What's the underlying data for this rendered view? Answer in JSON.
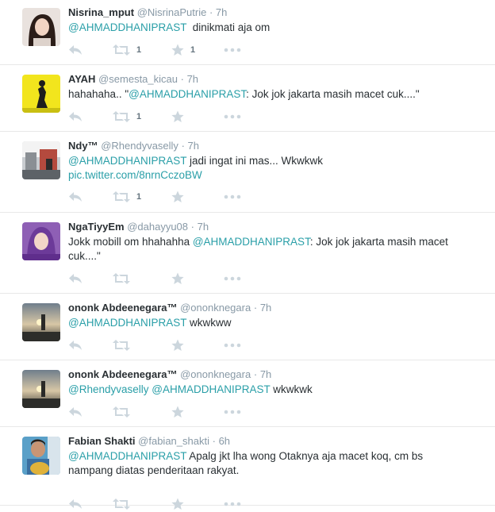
{
  "colors": {
    "link": "#2a9fa8",
    "muted": "#8899a6",
    "icon": "#ccd6dd"
  },
  "tweets": [
    {
      "fullname": "Nisrina_mput",
      "username": "@NisrinaPutrie",
      "sep": "·",
      "time": "7h",
      "text": [
        {
          "t": "@AHMADDHANIPRAST",
          "k": "mention"
        },
        {
          "t": "  dinikmati aja om",
          "k": "plain"
        }
      ],
      "retweets": "1",
      "favorites": "1",
      "avatar_icon": "avatar-girl-icon"
    },
    {
      "fullname": "AYAH",
      "username": "@semesta_kicau",
      "sep": "·",
      "time": "7h",
      "text": [
        {
          "t": "hahahaha.. \"",
          "k": "plain"
        },
        {
          "t": "@AHMADDHANIPRAST",
          "k": "mention"
        },
        {
          "t": ": Jok jok jakarta masih macet cuk....\"",
          "k": "plain"
        }
      ],
      "retweets": "1",
      "favorites": "",
      "avatar_icon": "avatar-yellow-figure-icon"
    },
    {
      "fullname": "Ndy™",
      "username": "@Rhendyvaselly",
      "sep": "·",
      "time": "7h",
      "text": [
        {
          "t": "@AHMADDHANIPRAST",
          "k": "mention"
        },
        {
          "t": " jadi ingat ini mas... Wkwkwk",
          "k": "plain"
        },
        {
          "t": "\n",
          "k": "br"
        },
        {
          "t": "pic.twitter.com/8nrnCczoBW",
          "k": "link"
        }
      ],
      "retweets": "1",
      "favorites": "",
      "avatar_icon": "avatar-street-icon"
    },
    {
      "fullname": "NgaTiyyEm",
      "username": "@dahayyu08",
      "sep": "·",
      "time": "7h",
      "text": [
        {
          "t": "Jokk mobill om hhahahha ",
          "k": "plain"
        },
        {
          "t": "@AHMADDHANIPRAST",
          "k": "mention"
        },
        {
          "t": ": Jok jok jakarta masih macet",
          "k": "plain"
        },
        {
          "t": "\n",
          "k": "br"
        },
        {
          "t": "cuk....\"",
          "k": "plain"
        }
      ],
      "retweets": "",
      "favorites": "",
      "avatar_icon": "avatar-hijab-icon"
    },
    {
      "fullname": "ononk Abdeenegara™",
      "username": "@ononknegara",
      "sep": "·",
      "time": "7h",
      "text": [
        {
          "t": "@AHMADDHANIPRAST",
          "k": "mention"
        },
        {
          "t": " wkwkww",
          "k": "plain"
        }
      ],
      "retweets": "",
      "favorites": "",
      "avatar_icon": "avatar-sunset-icon"
    },
    {
      "fullname": "ononk Abdeenegara™",
      "username": "@ononknegara",
      "sep": "·",
      "time": "7h",
      "text": [
        {
          "t": "@Rhendyvaselly",
          "k": "mention"
        },
        {
          "t": " ",
          "k": "plain"
        },
        {
          "t": "@AHMADDHANIPRAST",
          "k": "mention"
        },
        {
          "t": " wkwkwk",
          "k": "plain"
        }
      ],
      "retweets": "",
      "favorites": "",
      "avatar_icon": "avatar-sunset-icon"
    },
    {
      "fullname": "Fabian Shakti",
      "username": "@fabian_shakti",
      "sep": "·",
      "time": "6h",
      "text": [
        {
          "t": "@AHMADDHANIPRAST",
          "k": "mention"
        },
        {
          "t": " Apalg jkt lha wong Otaknya aja macet koq, cm bs",
          "k": "plain"
        },
        {
          "t": "\n",
          "k": "br"
        },
        {
          "t": "nampang diatas penderitaan rakyat.",
          "k": "plain"
        }
      ],
      "retweets": "",
      "favorites": "",
      "avatar_icon": "avatar-boy-guitar-icon"
    }
  ]
}
